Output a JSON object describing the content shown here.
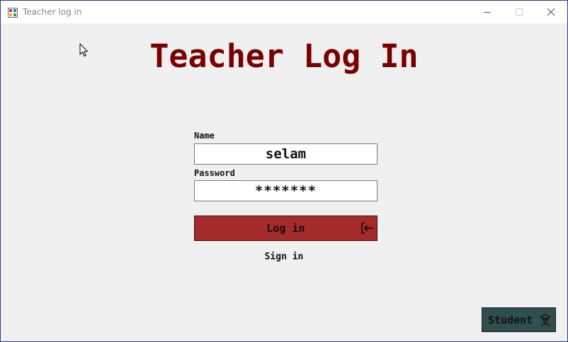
{
  "window": {
    "title": "Teacher log in",
    "icons": {
      "app": "app-form-icon",
      "minimize": "minimize-icon",
      "maximize": "maximize-icon",
      "close": "close-icon"
    }
  },
  "form": {
    "heading": "Teacher Log In",
    "name_label": "Name",
    "name_value": "selam",
    "password_label": "Password",
    "password_value": "*******",
    "login_label": "Log in",
    "login_icon": "login-arrow-icon",
    "signin_label": "Sign in",
    "student_label": "Student",
    "student_icon": "student-graduate-icon"
  },
  "colors": {
    "heading": "#7a0000",
    "login_button": "#a52a2a",
    "student_button": "#2f4f4f",
    "background": "#f0f0f0"
  }
}
